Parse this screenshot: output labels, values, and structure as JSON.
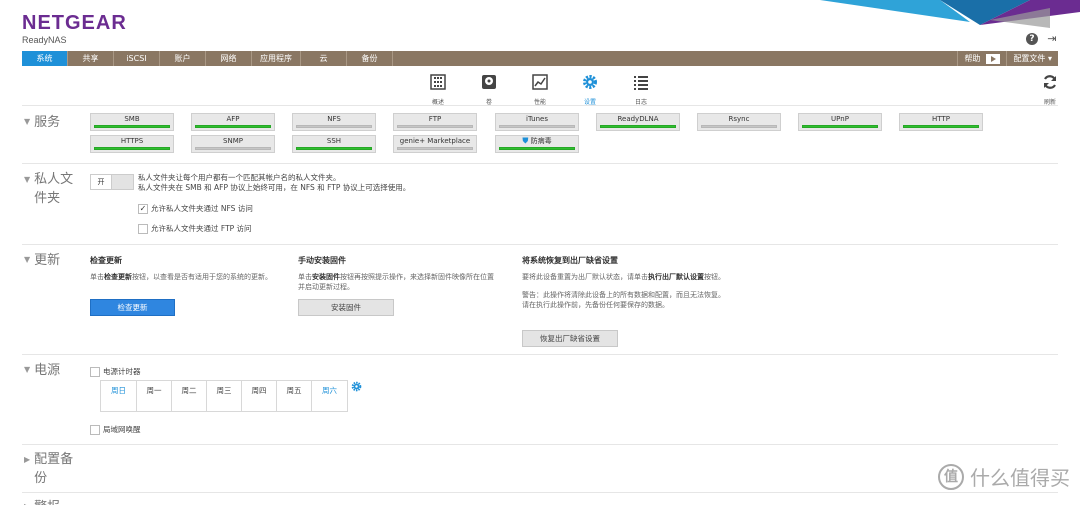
{
  "header": {
    "brand": "NETGEAR",
    "product": "ReadyNAS",
    "brand_color": "#6b2c91",
    "icons": [
      "help-icon",
      "logout-icon"
    ]
  },
  "nav": {
    "tabs": [
      "系统",
      "共享",
      "iSCSI",
      "账户",
      "网络",
      "应用程序",
      "云",
      "备份"
    ],
    "active_tab": "系统",
    "help_label": "帮助",
    "config_label": "配置文件 ▾",
    "accent": "#1e90d8"
  },
  "toolbar": {
    "items": [
      {
        "label": "概述",
        "icon": "overview-icon"
      },
      {
        "label": "卷",
        "icon": "volume-icon"
      },
      {
        "label": "性能",
        "icon": "performance-icon"
      },
      {
        "label": "设置",
        "icon": "settings-icon"
      },
      {
        "label": "日志",
        "icon": "logs-icon"
      }
    ],
    "active_item": "设置",
    "refresh_label": "刷新"
  },
  "services": {
    "title": "服务",
    "items": [
      {
        "label": "SMB",
        "enabled": true
      },
      {
        "label": "AFP",
        "enabled": true
      },
      {
        "label": "NFS",
        "enabled": false
      },
      {
        "label": "FTP",
        "enabled": false
      },
      {
        "label": "iTunes",
        "enabled": false
      },
      {
        "label": "ReadyDLNA",
        "enabled": true
      },
      {
        "label": "Rsync",
        "enabled": false
      },
      {
        "label": "UPnP",
        "enabled": true
      },
      {
        "label": "HTTP",
        "enabled": true
      },
      {
        "label": "HTTPS",
        "enabled": true
      },
      {
        "label": "SNMP",
        "enabled": false
      },
      {
        "label": "SSH",
        "enabled": true
      },
      {
        "label": "genie+ Marketplace",
        "enabled": false
      },
      {
        "label": "防病毒",
        "enabled": true
      }
    ]
  },
  "private_folder": {
    "title": "私人文件夹",
    "toggle_label": "开",
    "line1": "私人文件夹让每个用户都有一个匹配其帐户名的私人文件夹。",
    "line2": "私人文件夹在 SMB 和 AFP 协议上始终可用，在 NFS 和 FTP 协议上可选择使用。",
    "nfs_checkbox": {
      "label": "允许私人文件夹通过 NFS 访问",
      "checked": true
    },
    "ftp_checkbox": {
      "label": "允许私人文件夹通过 FTP 访问",
      "checked": false
    }
  },
  "update": {
    "title": "更新",
    "check": {
      "heading": "检查更新",
      "desc_pre": "单击",
      "desc_bold": "检查更新",
      "desc_post": "按钮，以查看是否有适用于您的系统的更新。",
      "button": "检查更新"
    },
    "manual": {
      "heading": "手动安装固件",
      "desc_pre": "单击",
      "desc_bold": "安装固件",
      "desc_post": "按钮再按照提示操作，来选择新固件映像所在位置并启动更新过程。",
      "button": "安装固件"
    },
    "reset": {
      "heading": "将系统恢复到出厂缺省设置",
      "desc_pre": "要将此设备重置为出厂默认状态，请单击",
      "desc_bold": "执行出厂默认设置",
      "desc_post": "按钮。",
      "warning": "警告：此操作将清除此设备上的所有数据和配置，而且无法恢复。请在执行此操作前，先备份任何要保存的数据。",
      "button": "恢复出厂缺省设置"
    }
  },
  "power": {
    "title": "电源",
    "timer_label": "电源计时器",
    "days": [
      "周日",
      "周一",
      "周二",
      "周三",
      "周四",
      "周五",
      "周六"
    ],
    "wol_label": "局域网唤醒"
  },
  "config_backup": {
    "title": "配置备份"
  },
  "next_section": {
    "title": "警报"
  },
  "watermark": {
    "symbol": "值",
    "text": "什么值得买"
  }
}
